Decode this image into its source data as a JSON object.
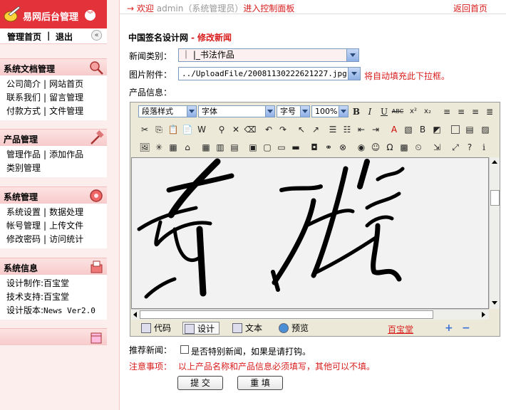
{
  "brand": {
    "title": "易网后台管理"
  },
  "topnav": {
    "home": "管理首页",
    "sep": "|",
    "logout": "退出"
  },
  "sections": [
    {
      "title": "系统文档管理",
      "rows": [
        [
          "公司简介",
          "网站首页"
        ],
        [
          "联系我们",
          "留言管理"
        ],
        [
          "付款方式",
          "文件管理"
        ]
      ]
    },
    {
      "title": "产品管理",
      "rows": [
        [
          "管理作品",
          "添加作品"
        ],
        [
          "类别管理"
        ]
      ]
    },
    {
      "title": "系统管理",
      "rows": [
        [
          "系统设置",
          "数据处理"
        ],
        [
          "帐号管理",
          "上传文件"
        ],
        [
          "修改密码",
          "访问统计"
        ]
      ]
    },
    {
      "title": "系统信息",
      "rows": [
        [
          "设计制作:百宝堂"
        ],
        [
          "技术支持:百宝堂"
        ],
        [
          "设计版本:",
          "News Ver2.0"
        ]
      ]
    }
  ],
  "header": {
    "arrow": "→",
    "welcome_prefix": "欢迎",
    "user": "admin（系统管理员）",
    "welcome_suffix": "进入控制面板",
    "back_home": "返回首页"
  },
  "breadcrumb": {
    "site": "中国签名设计网",
    "dash": "-",
    "current": "修改新闻"
  },
  "form": {
    "category_label": "新闻类别：",
    "category_value": "｜ |_书法作品",
    "attachment_label": "图片附件：",
    "attachment_value": "../UploadFile/20081130222621227.jpg",
    "attachment_hint": "将自动填充此下拉框。",
    "product_info_label": "产品信息：",
    "recommend_label": "推荐新闻：",
    "recommend_text": "是否特别新闻，如果是请打钩。",
    "notice_label": "注意事项：",
    "notice_text": "以上产品名称和产品信息必须填写，其他可以不填。",
    "submit": "提 交",
    "reset": "重 填"
  },
  "editor": {
    "paragraph_style": "段落样式",
    "font_face": "字体",
    "font_size": "字号",
    "zoom": "100%",
    "bold": "B",
    "italic": "I",
    "underline": "U",
    "strike": "ABC",
    "sup": "x²",
    "sub": "x₂",
    "mode_tabs": [
      "代码",
      "设计",
      "文本",
      "预览"
    ],
    "active_tab": "设计",
    "baobao": "百宝堂",
    "plus": "+",
    "minus": "−"
  },
  "colors": {
    "brand_red": "#e4323a",
    "accent_red": "#d81c1c",
    "sidebar_bg": "#fdeeee"
  }
}
